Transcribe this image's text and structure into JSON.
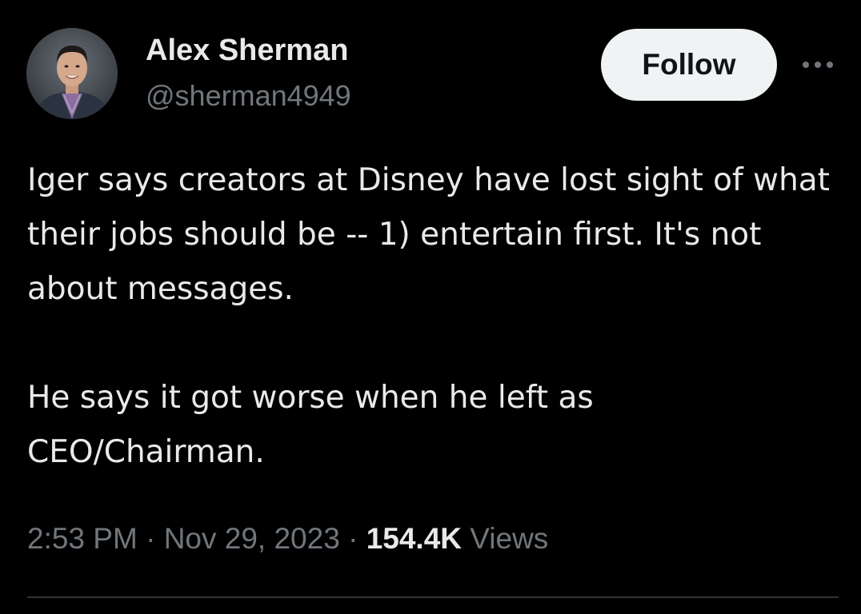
{
  "author": {
    "display_name": "Alex Sherman",
    "handle": "@sherman4949",
    "avatar_icon": "profile-photo-icon"
  },
  "actions": {
    "follow_label": "Follow",
    "more_icon": "more-options-icon"
  },
  "tweet": {
    "paragraphs": [
      "Iger says creators at Disney have lost sight of what their jobs should be -- 1) entertain first. It's not about messages.",
      "He says it got worse when he left as CEO/Chairman."
    ]
  },
  "meta": {
    "time": "2:53 PM",
    "separator": "·",
    "date": "Nov 29, 2023",
    "views_count": "154.4K",
    "views_label": "Views"
  },
  "colors": {
    "background": "#000000",
    "primary_text": "#e7e9ea",
    "secondary_text": "#71767b",
    "follow_button_bg": "#eff3f4",
    "divider": "#2f3336"
  }
}
